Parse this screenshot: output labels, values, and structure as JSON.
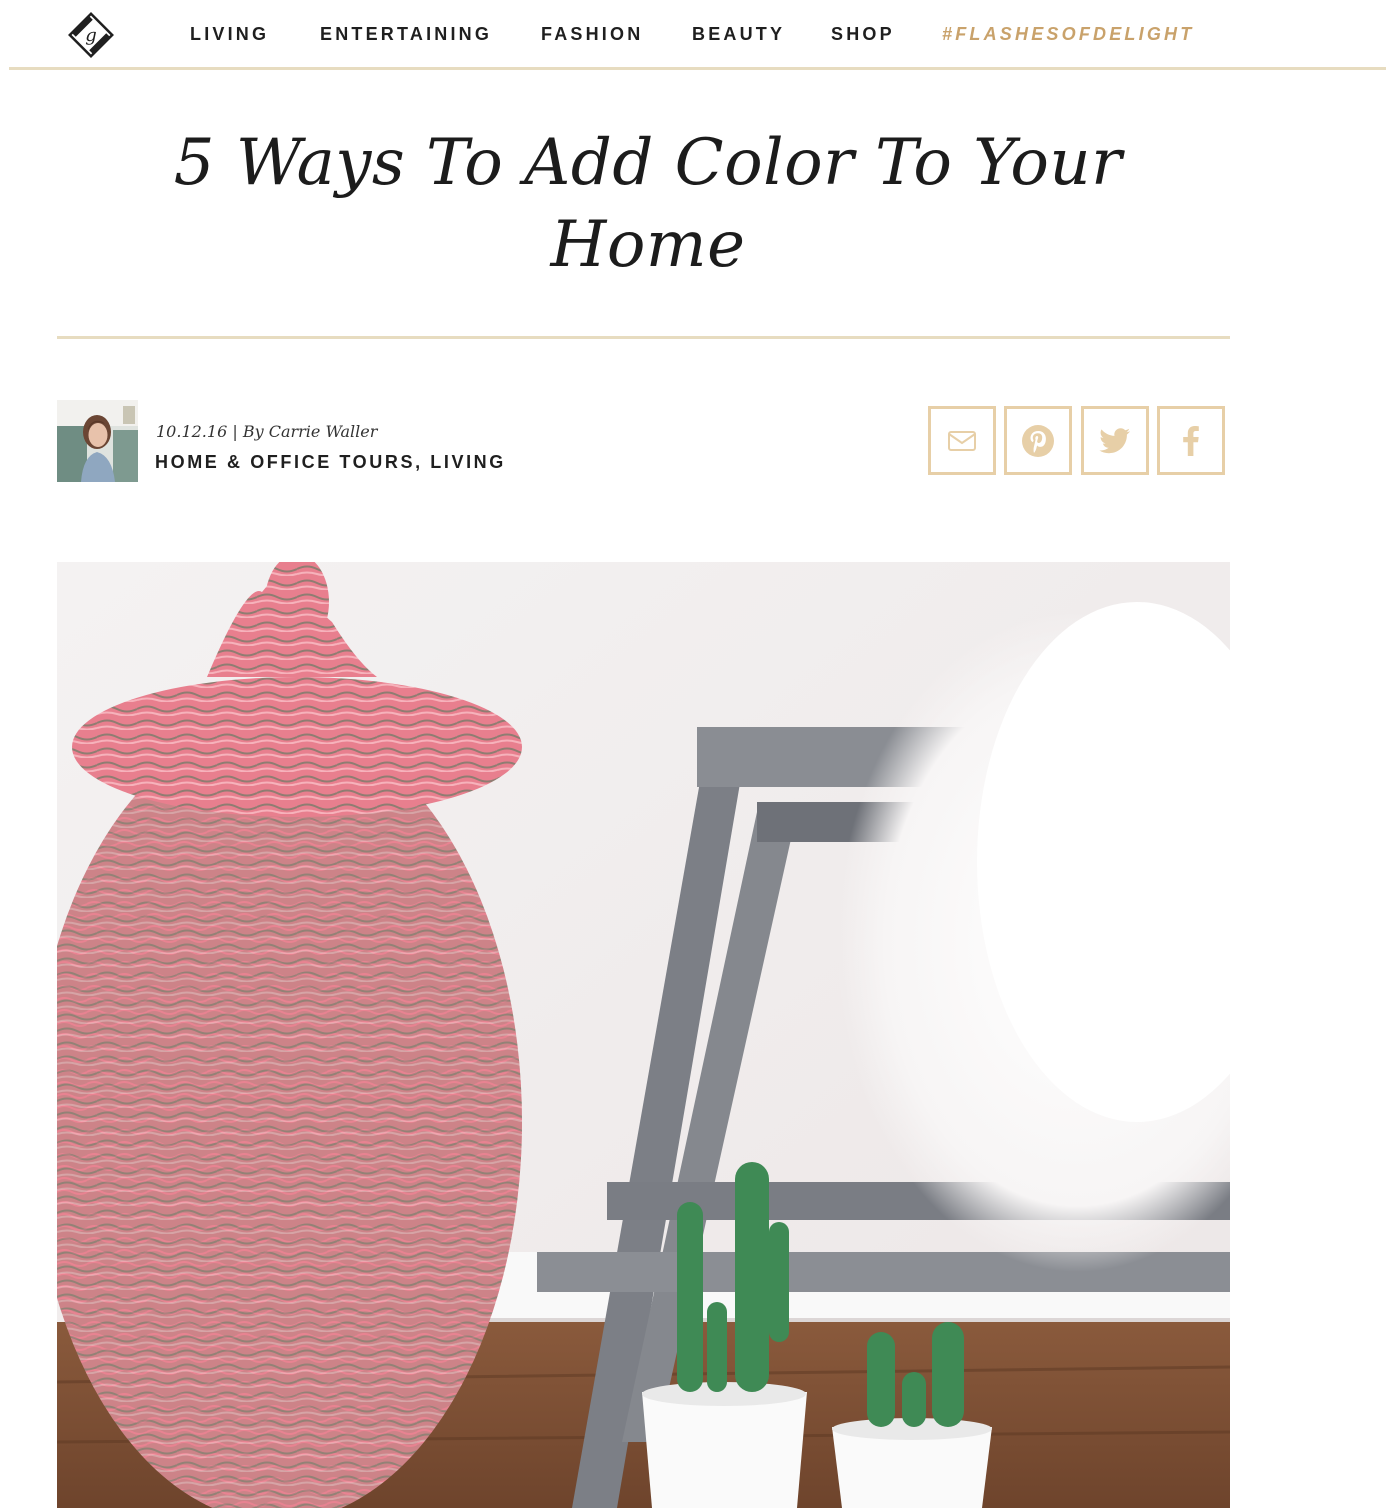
{
  "header": {
    "logo_letter": "g",
    "nav": [
      {
        "label": "LIVING"
      },
      {
        "label": "ENTERTAINING"
      },
      {
        "label": "FASHION"
      },
      {
        "label": "BEAUTY"
      },
      {
        "label": "SHOP"
      },
      {
        "label": "#FLASHESOFDELIGHT"
      }
    ]
  },
  "article": {
    "title": "5 Ways To Add Color To Your Home",
    "date": "10.12.16",
    "byline_sep": " | ",
    "byline": "By Carrie Waller",
    "categories": [
      {
        "label": "HOME & OFFICE TOURS"
      },
      {
        "label": "LIVING"
      }
    ],
    "category_sep": ", "
  },
  "share": [
    {
      "icon": "mail-icon"
    },
    {
      "icon": "pinterest-icon"
    },
    {
      "icon": "twitter-icon"
    },
    {
      "icon": "facebook-icon"
    }
  ],
  "colors": {
    "accent_gold": "#c9a26b",
    "rule_beige": "#e7dcc0",
    "share_border": "#e7cfa7",
    "text_dark": "#1f1f1f"
  }
}
